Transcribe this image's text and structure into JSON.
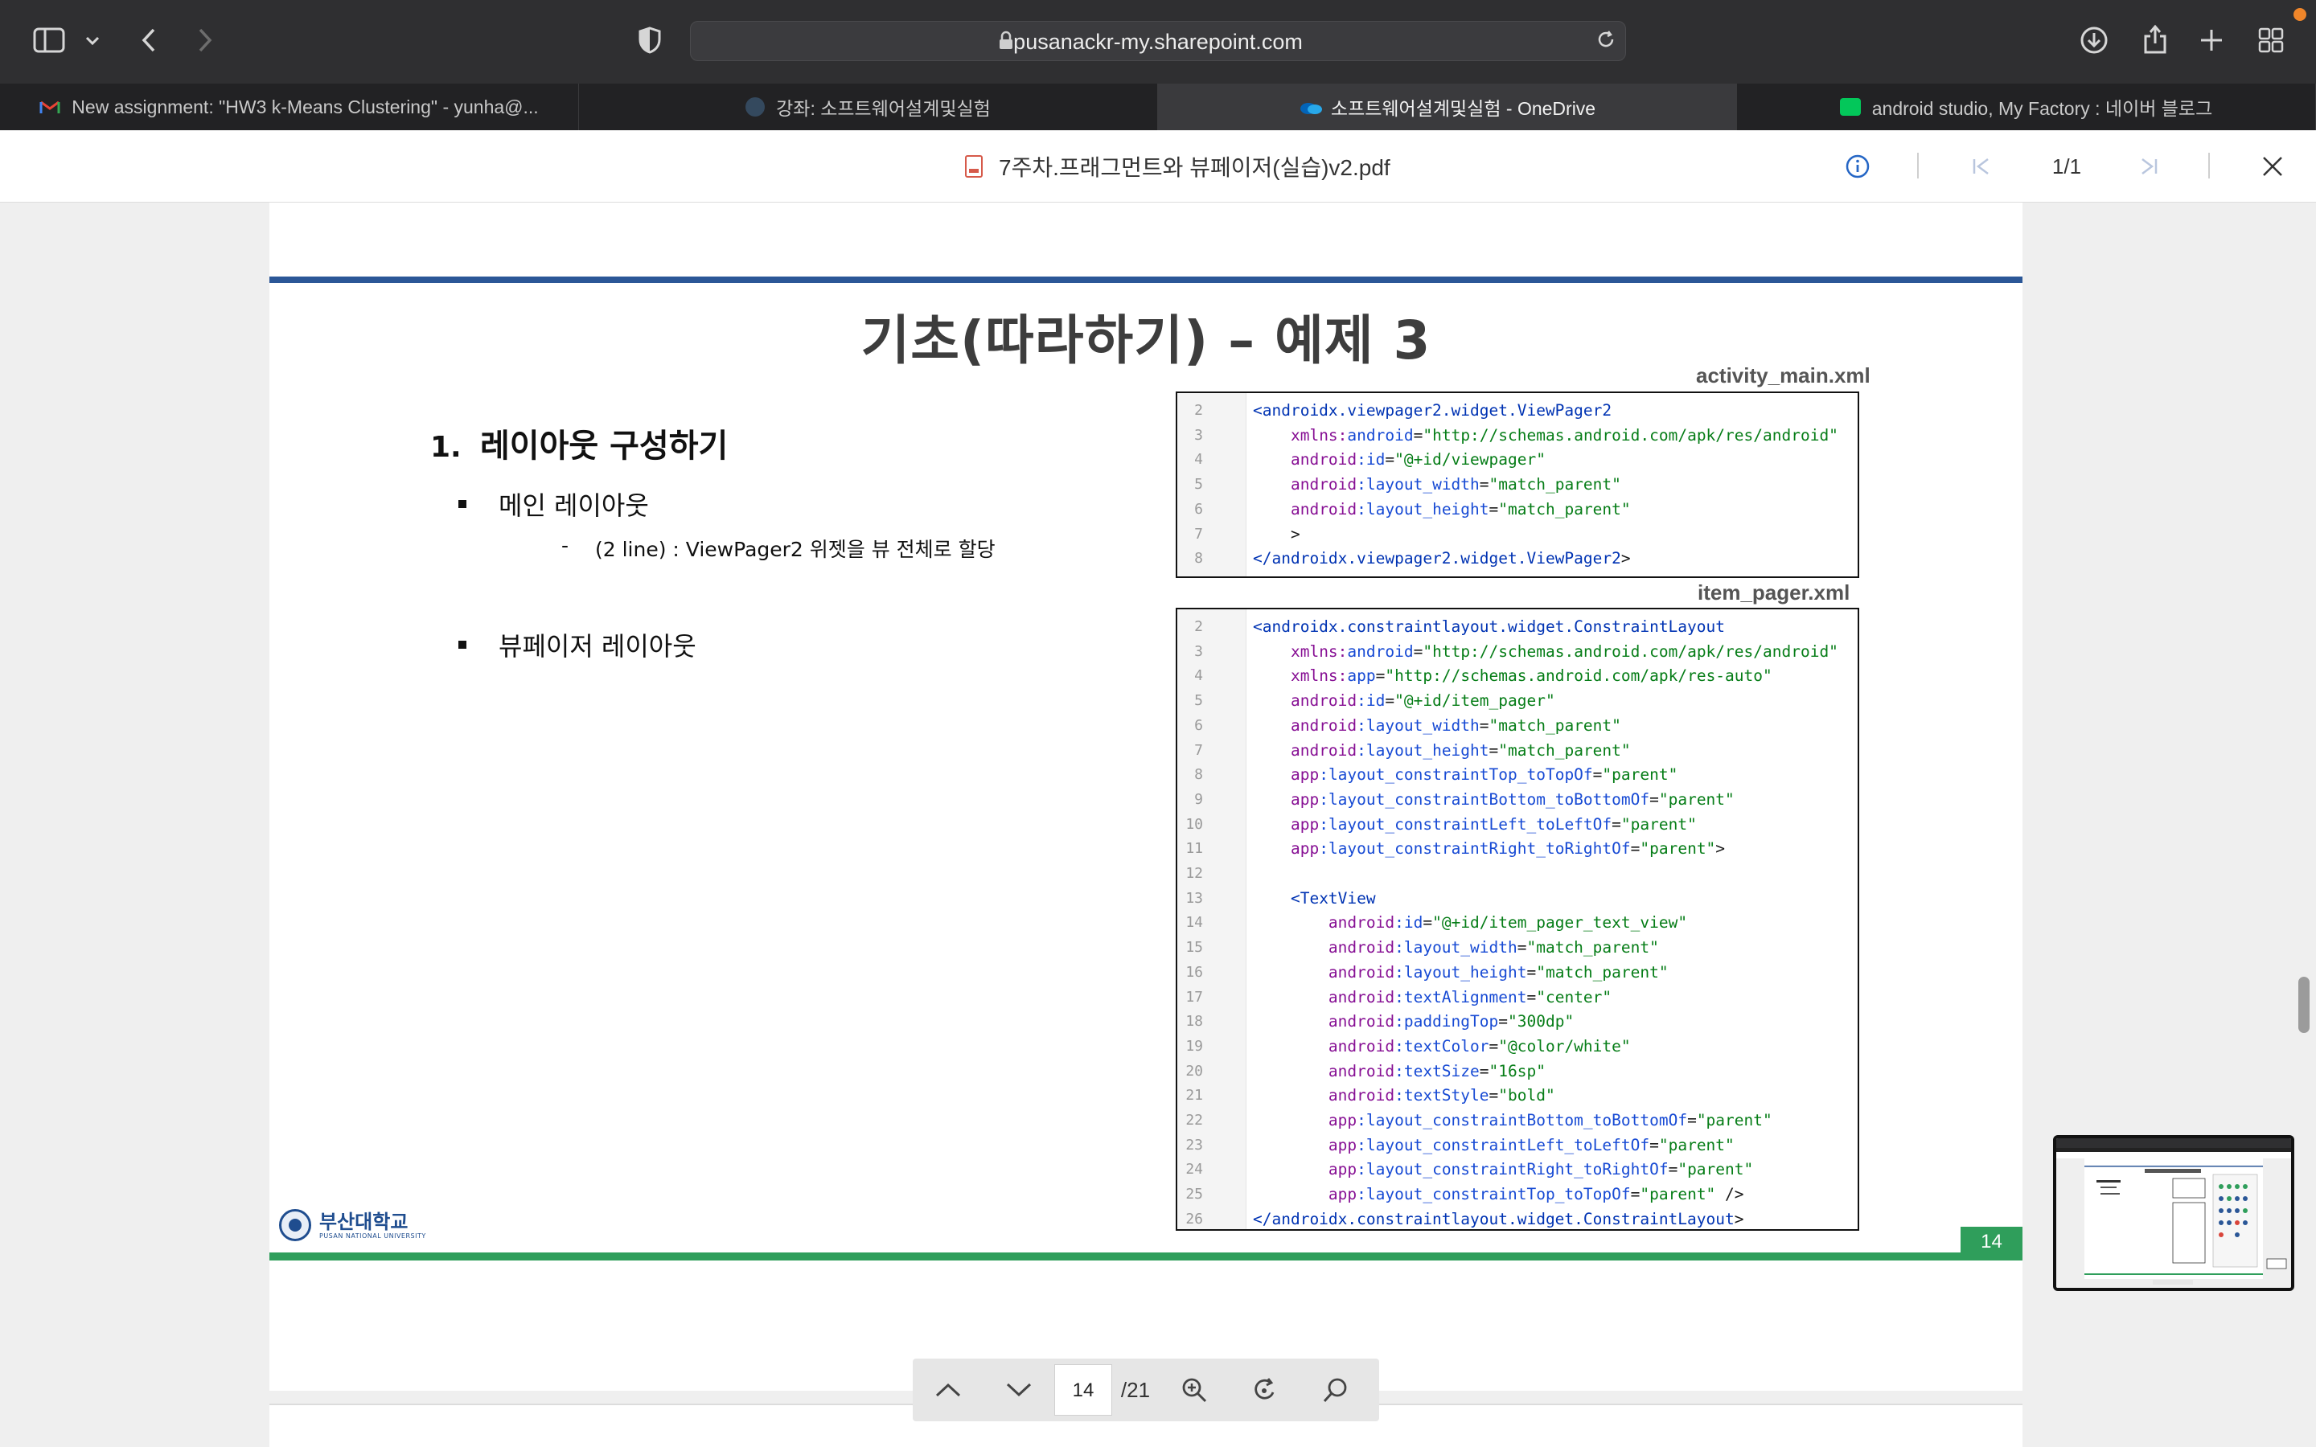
{
  "browser": {
    "url": "pusanackr-my.sharepoint.com",
    "tabs": [
      {
        "label": "New assignment: \"HW3 k-Means Clustering\" - yunha@...",
        "icon": "gmail-icon"
      },
      {
        "label": "강좌: 소프트웨어설계및실험",
        "icon": "course-icon"
      },
      {
        "label": "소프트웨어설계및실험 - OneDrive",
        "icon": "onedrive-icon",
        "active": true
      },
      {
        "label": "android studio, My Factory : 네이버 블로그",
        "icon": "naver-blog-icon"
      }
    ]
  },
  "pdf_header": {
    "filename": "7주차.프래그먼트와 뷰페이저(실습)v2.pdf",
    "page_indicator": "1/1"
  },
  "slide": {
    "title": "기초(따라하기) – 예제 3",
    "section_number": "1.",
    "section_title": "레이아웃 구성하기",
    "bullet1": "메인 레이아웃",
    "bullet1_sub_dash": "-",
    "bullet1_sub": "(2 line) : ViewPager2 위젯을 뷰 전체로 할당",
    "bullet2": "뷰페이저 레이아웃",
    "code1_label": "activity_main.xml",
    "code1_lines": [
      {
        "n": "2",
        "parts": [
          [
            "t",
            "<androidx.viewpager2.widget.ViewPager2"
          ]
        ]
      },
      {
        "n": "3",
        "parts": [
          [
            "p",
            "    "
          ],
          [
            "ns",
            "xmlns:"
          ],
          [
            "a",
            "android"
          ],
          [
            "p",
            "="
          ],
          [
            "v",
            "\"http://schemas.android.com/apk/res/android\""
          ]
        ]
      },
      {
        "n": "4",
        "parts": [
          [
            "p",
            "    "
          ],
          [
            "ns",
            "android"
          ],
          [
            "a",
            ":id"
          ],
          [
            "p",
            "="
          ],
          [
            "v",
            "\"@+id/viewpager\""
          ]
        ]
      },
      {
        "n": "5",
        "parts": [
          [
            "p",
            "    "
          ],
          [
            "ns",
            "android"
          ],
          [
            "a",
            ":layout_width"
          ],
          [
            "p",
            "="
          ],
          [
            "v",
            "\"match_parent\""
          ]
        ]
      },
      {
        "n": "6",
        "parts": [
          [
            "p",
            "    "
          ],
          [
            "ns",
            "android"
          ],
          [
            "a",
            ":layout_height"
          ],
          [
            "p",
            "="
          ],
          [
            "v",
            "\"match_parent\""
          ]
        ]
      },
      {
        "n": "7",
        "parts": [
          [
            "p",
            "    >"
          ]
        ]
      },
      {
        "n": "8",
        "parts": [
          [
            "t",
            "</androidx.viewpager2.widget.ViewPager2"
          ],
          [
            "p",
            ">"
          ]
        ]
      }
    ],
    "code2_label": "item_pager.xml",
    "code2_lines": [
      {
        "n": "2",
        "parts": [
          [
            "t",
            "<androidx.constraintlayout.widget.ConstraintLayout"
          ]
        ]
      },
      {
        "n": "3",
        "parts": [
          [
            "p",
            "    "
          ],
          [
            "ns",
            "xmlns:"
          ],
          [
            "a",
            "android"
          ],
          [
            "p",
            "="
          ],
          [
            "v",
            "\"http://schemas.android.com/apk/res/android\""
          ]
        ]
      },
      {
        "n": "4",
        "parts": [
          [
            "p",
            "    "
          ],
          [
            "ns",
            "xmlns:"
          ],
          [
            "a",
            "app"
          ],
          [
            "p",
            "="
          ],
          [
            "v",
            "\"http://schemas.android.com/apk/res-auto\""
          ]
        ]
      },
      {
        "n": "5",
        "parts": [
          [
            "p",
            "    "
          ],
          [
            "ns",
            "android"
          ],
          [
            "a",
            ":id"
          ],
          [
            "p",
            "="
          ],
          [
            "v",
            "\"@+id/item_pager\""
          ]
        ]
      },
      {
        "n": "6",
        "parts": [
          [
            "p",
            "    "
          ],
          [
            "ns",
            "android"
          ],
          [
            "a",
            ":layout_width"
          ],
          [
            "p",
            "="
          ],
          [
            "v",
            "\"match_parent\""
          ]
        ]
      },
      {
        "n": "7",
        "parts": [
          [
            "p",
            "    "
          ],
          [
            "ns",
            "android"
          ],
          [
            "a",
            ":layout_height"
          ],
          [
            "p",
            "="
          ],
          [
            "v",
            "\"match_parent\""
          ]
        ]
      },
      {
        "n": "8",
        "parts": [
          [
            "p",
            "    "
          ],
          [
            "ns",
            "app"
          ],
          [
            "a",
            ":layout_constraintTop_toTopOf"
          ],
          [
            "p",
            "="
          ],
          [
            "v",
            "\"parent\""
          ]
        ]
      },
      {
        "n": "9",
        "parts": [
          [
            "p",
            "    "
          ],
          [
            "ns",
            "app"
          ],
          [
            "a",
            ":layout_constraintBottom_toBottomOf"
          ],
          [
            "p",
            "="
          ],
          [
            "v",
            "\"parent\""
          ]
        ]
      },
      {
        "n": "10",
        "parts": [
          [
            "p",
            "    "
          ],
          [
            "ns",
            "app"
          ],
          [
            "a",
            ":layout_constraintLeft_toLeftOf"
          ],
          [
            "p",
            "="
          ],
          [
            "v",
            "\"parent\""
          ]
        ]
      },
      {
        "n": "11",
        "parts": [
          [
            "p",
            "    "
          ],
          [
            "ns",
            "app"
          ],
          [
            "a",
            ":layout_constraintRight_toRightOf"
          ],
          [
            "p",
            "="
          ],
          [
            "v",
            "\"parent\""
          ],
          [
            "p",
            ">"
          ]
        ]
      },
      {
        "n": "12",
        "parts": []
      },
      {
        "n": "13",
        "parts": [
          [
            "p",
            "    "
          ],
          [
            "t",
            "<TextView"
          ]
        ]
      },
      {
        "n": "14",
        "parts": [
          [
            "p",
            "        "
          ],
          [
            "ns",
            "android"
          ],
          [
            "a",
            ":id"
          ],
          [
            "p",
            "="
          ],
          [
            "v",
            "\"@+id/item_pager_text_view\""
          ]
        ]
      },
      {
        "n": "15",
        "parts": [
          [
            "p",
            "        "
          ],
          [
            "ns",
            "android"
          ],
          [
            "a",
            ":layout_width"
          ],
          [
            "p",
            "="
          ],
          [
            "v",
            "\"match_parent\""
          ]
        ]
      },
      {
        "n": "16",
        "parts": [
          [
            "p",
            "        "
          ],
          [
            "ns",
            "android"
          ],
          [
            "a",
            ":layout_height"
          ],
          [
            "p",
            "="
          ],
          [
            "v",
            "\"match_parent\""
          ]
        ]
      },
      {
        "n": "17",
        "parts": [
          [
            "p",
            "        "
          ],
          [
            "ns",
            "android"
          ],
          [
            "a",
            ":textAlignment"
          ],
          [
            "p",
            "="
          ],
          [
            "v",
            "\"center\""
          ]
        ]
      },
      {
        "n": "18",
        "parts": [
          [
            "p",
            "        "
          ],
          [
            "ns",
            "android"
          ],
          [
            "a",
            ":paddingTop"
          ],
          [
            "p",
            "="
          ],
          [
            "v",
            "\"300dp\""
          ]
        ]
      },
      {
        "n": "19",
        "parts": [
          [
            "p",
            "        "
          ],
          [
            "ns",
            "android"
          ],
          [
            "a",
            ":textColor"
          ],
          [
            "p",
            "="
          ],
          [
            "v",
            "\"@color/white\""
          ]
        ]
      },
      {
        "n": "20",
        "parts": [
          [
            "p",
            "        "
          ],
          [
            "ns",
            "android"
          ],
          [
            "a",
            ":textSize"
          ],
          [
            "p",
            "="
          ],
          [
            "v",
            "\"16sp\""
          ]
        ]
      },
      {
        "n": "21",
        "parts": [
          [
            "p",
            "        "
          ],
          [
            "ns",
            "android"
          ],
          [
            "a",
            ":textStyle"
          ],
          [
            "p",
            "="
          ],
          [
            "v",
            "\"bold\""
          ]
        ]
      },
      {
        "n": "22",
        "parts": [
          [
            "p",
            "        "
          ],
          [
            "ns",
            "app"
          ],
          [
            "a",
            ":layout_constraintBottom_toBottomOf"
          ],
          [
            "p",
            "="
          ],
          [
            "v",
            "\"parent\""
          ]
        ]
      },
      {
        "n": "23",
        "parts": [
          [
            "p",
            "        "
          ],
          [
            "ns",
            "app"
          ],
          [
            "a",
            ":layout_constraintLeft_toLeftOf"
          ],
          [
            "p",
            "="
          ],
          [
            "v",
            "\"parent\""
          ]
        ]
      },
      {
        "n": "24",
        "parts": [
          [
            "p",
            "        "
          ],
          [
            "ns",
            "app"
          ],
          [
            "a",
            ":layout_constraintRight_toRightOf"
          ],
          [
            "p",
            "="
          ],
          [
            "v",
            "\"parent\""
          ]
        ]
      },
      {
        "n": "25",
        "parts": [
          [
            "p",
            "        "
          ],
          [
            "ns",
            "app"
          ],
          [
            "a",
            ":layout_constraintTop_toTopOf"
          ],
          [
            "p",
            "="
          ],
          [
            "v",
            "\"parent\""
          ],
          [
            "p",
            " />"
          ]
        ]
      },
      {
        "n": "26",
        "parts": [
          [
            "t",
            "</androidx.constraintlayout.widget.ConstraintLayout"
          ],
          [
            "p",
            ">"
          ]
        ]
      }
    ],
    "logo_kr": "부산대학교",
    "logo_en": "PUSAN NATIONAL UNIVERSITY",
    "slide_page_number": "14"
  },
  "nav": {
    "current_page": "14",
    "total_pages": "/21"
  },
  "colors": {
    "title_bar_blue": "#2b5797",
    "footer_green": "#2f9e5b",
    "safari_dark": "#2f2f31"
  }
}
